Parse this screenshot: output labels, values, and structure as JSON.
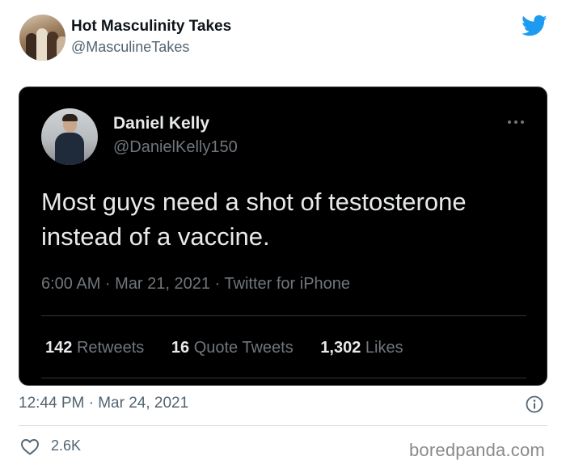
{
  "outer_tweet": {
    "display_name": "Hot Masculinity Takes",
    "handle": "@MasculineTakes",
    "timestamp": "12:44 PM · Mar 24, 2021",
    "like_count": "2.6K",
    "brand_color": "#1d9bf0"
  },
  "quoted_tweet": {
    "display_name": "Daniel Kelly",
    "handle": "@DanielKelly150",
    "text": "Most guys need a shot of testosterone instead of a vaccine.",
    "meta": "6:00 AM · Mar 21, 2021 · Twitter for iPhone",
    "stats": [
      {
        "count": "142",
        "label": "Retweets"
      },
      {
        "count": "16",
        "label": "Quote Tweets"
      },
      {
        "count": "1,302",
        "label": "Likes"
      }
    ]
  },
  "watermark": "boredpanda.com",
  "icons": {
    "brand": "twitter-bird-icon",
    "more": "more-dots-icon",
    "info": "info-icon",
    "like": "heart-icon"
  }
}
